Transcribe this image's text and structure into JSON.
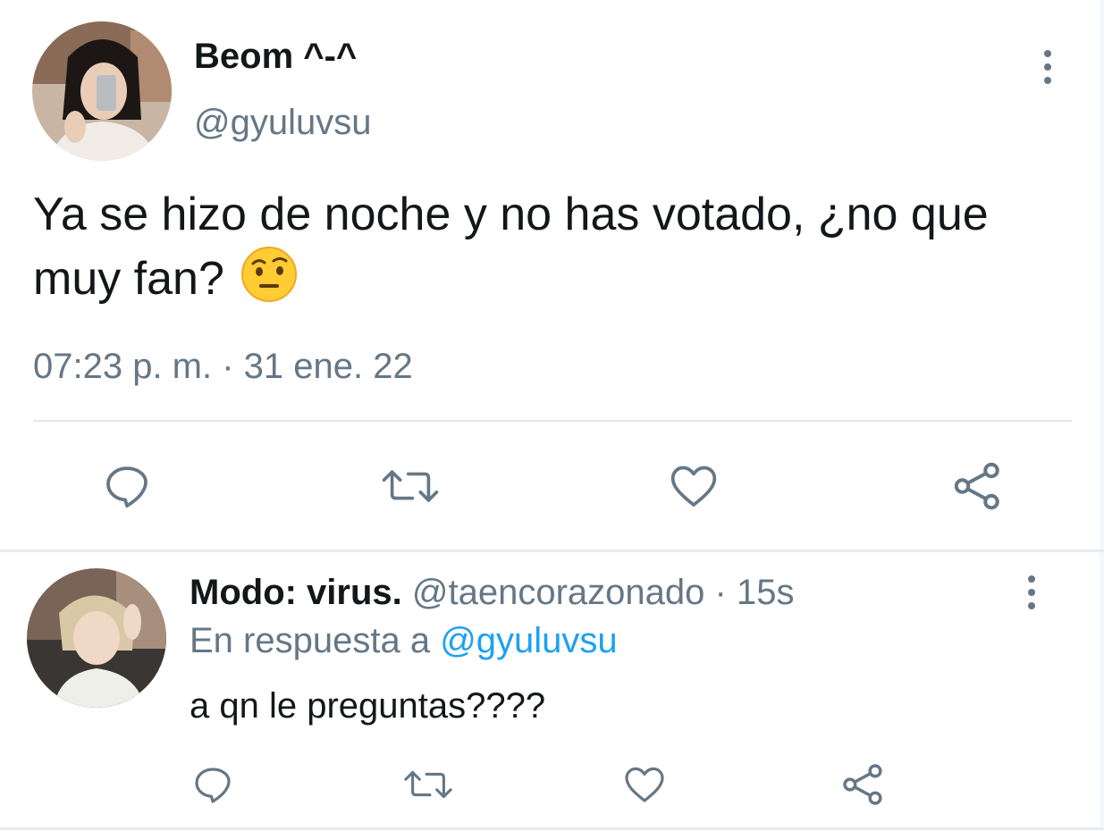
{
  "main_tweet": {
    "author_name": "Beom ^-^",
    "author_handle": "@gyuluvsu",
    "text": "Ya se hizo de noche y no has votado, ¿no que muy fan?",
    "emoji": "face-with-raised-eyebrow",
    "timestamp": "07:23 p. m. · 31 ene. 22",
    "actions": [
      "reply-icon",
      "retweet-icon",
      "like-icon",
      "share-icon"
    ]
  },
  "reply_tweet": {
    "author_name": "Modo: virus.",
    "author_handle": "@taencorazonado",
    "separator": " · ",
    "time_ago": "15s",
    "in_reply_prefix": "En respuesta a ",
    "in_reply_handle": "@gyuluvsu",
    "text": "a qn le preguntas????",
    "actions": [
      "reply-icon",
      "retweet-icon",
      "like-icon",
      "share-icon"
    ]
  },
  "colors": {
    "text": "#14171a",
    "secondary": "#657786",
    "link": "#1da1f2",
    "divider": "#e1e8ed"
  }
}
